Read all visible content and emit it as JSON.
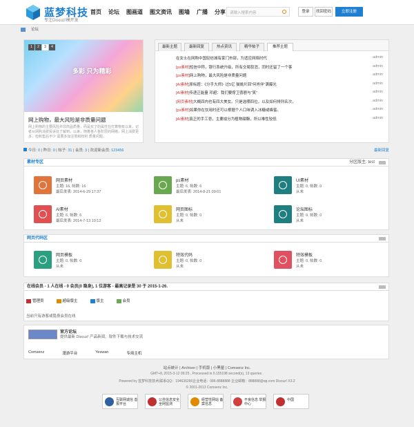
{
  "header": {
    "brand": "蓝梦科技",
    "brand_sub": "专注Discuz!模开发",
    "nav": [
      "首页",
      "论坛",
      "图画道",
      "图文资讯",
      "图墙",
      "广播",
      "分享"
    ],
    "search_placeholder": "请输入搜索内容",
    "login": "登录",
    "forgot": "找回密码",
    "register": "立即注册"
  },
  "breadcrumb": {
    "item": "论坛"
  },
  "slider": {
    "pages": [
      "1",
      "2",
      "3",
      "4"
    ],
    "active_page": "3",
    "image_text": "多彩 只为精彩",
    "title": "网上购物，最大风险是非质量问题",
    "desc": "网上购物的主要风险并非商品质量，而是买了的属性在打算物有以来，记者从网购消费投诉处了解到，以来，随着各人各阶层的网络，网上消费更多，但和售后不少 需要多加注意和权利 质量问题。"
  },
  "tabs": {
    "items": [
      "最新主题",
      "最新回复",
      "热点资讯",
      "精华帖子",
      "推荐主题"
    ],
    "active": "推荐主题",
    "threads": [
      {
        "tag": "",
        "title": "在女士在网购中国轻纺城有家门市部，为适应网络时代",
        "author": "admin"
      },
      {
        "tag": "[ps素材]",
        "title": "短信中称，银行系统升级，所有交易取消，同时还留了一个客",
        "author": "admin"
      },
      {
        "tag": "[ps素材]",
        "title": "网上购物，最大风险是非质量问题",
        "author": "admin"
      },
      {
        "tag": "[AI素材]",
        "title": "原标题：《分手大师》过5亿 猫姚片回“何肖伴”满曝光",
        "author": "admin"
      },
      {
        "tag": "[AI素材]",
        "title": "传递正能量 邓超：我们要撑卫喜剧与“笑”",
        "author": "admin"
      },
      {
        "tag": "[网页素材]",
        "title": "大概四内也有四大美女。只是选哪四位，以及如何排列名次，",
        "author": "admin"
      },
      {
        "tag": "[ps素材]",
        "title": "如果你在饮用时还可以根据个人口味调入冰糖或蜂蜜。",
        "author": "admin"
      },
      {
        "tag": "[AI素材]",
        "title": "真正的手工皂，主要成分为植物甜酯，所以唯性较低",
        "author": "admin"
      }
    ]
  },
  "stats": {
    "today_label": "今日:",
    "today": "0",
    "yesterday_label": "昨日:",
    "yesterday": "0",
    "posts_label": "帖子:",
    "posts": "31",
    "members_label": "会员:",
    "members": "3",
    "welcome_label": "欢迎新会员:",
    "welcome": "123456",
    "newest": "最新回复"
  },
  "section1": {
    "title": "素材专区",
    "right": "分区版主: test",
    "forums": [
      {
        "name": "网页素材",
        "line1": "主题: 16, 帖数: 16",
        "line2": "最后发表: 2014-6-29 17:37",
        "color": "#e0743a"
      },
      {
        "name": "ps素材",
        "line1": "主题: 6, 帖数: 6",
        "line2": "最后发表: 2014-8-21 09:01",
        "color": "#6aa84f"
      },
      {
        "name": "UI素材",
        "line1": "主题: 0, 帖数: 0",
        "line2": "从未",
        "color": "#1f7f80"
      },
      {
        "name": "AI素材",
        "line1": "主题: 6, 帖数: 6",
        "line2": "最后发表: 2014-7-13 10:12",
        "color": "#e05050"
      },
      {
        "name": "网页图标",
        "line1": "主题: 0, 帖数: 0",
        "line2": "从未",
        "color": "#e0c030"
      },
      {
        "name": "论坛图标",
        "line1": "主题: 0, 帖数: 0",
        "line2": "从未",
        "color": "#1f7f80"
      }
    ]
  },
  "section2": {
    "title": "网页代码区",
    "forums": [
      {
        "name": "网页模板",
        "line1": "主题: 0, 帖数: 0",
        "line2": "从未",
        "color": "#2aa080"
      },
      {
        "name": "特效代码",
        "line1": "主题: 0, 帖数: 0",
        "line2": "从未",
        "color": "#e0c030"
      },
      {
        "name": "特效模板",
        "line1": "主题: 0, 帖数: 0",
        "line2": "从未",
        "color": "#e05060"
      }
    ]
  },
  "online": {
    "title": "在线会员 - 1 人在线 - 0 会员(0 隐身), 1 位游客 - 最高记录是 30 于 2015-1-26.",
    "legend": [
      {
        "label": "管理员",
        "color": "#c03030"
      },
      {
        "label": "超级版主",
        "color": "#e08a00"
      },
      {
        "label": "版主",
        "color": "#1f7fd0"
      },
      {
        "label": "会员",
        "color": "#6aa84f"
      }
    ],
    "note": "当前只有游客或隐身会员在线"
  },
  "partner": {
    "name": "官方论坛",
    "desc": "提供最新 Discuz! 产品新闻、软件下载与技术交流",
    "links": [
      "Comsenz",
      "漫游平台",
      "Yeswan",
      "专用主机"
    ]
  },
  "footer": {
    "line1": "站点统计 | Archiver | 手机版 | 小黑屋 | Comsenz Inc.",
    "line2": "GMT+8, 2015-3-12 09:25 , Processed in 0.155198 second(s), 13 queries .",
    "line3": "Powered by 蓝梦科技技术|联系QQ：194636266企业电话：086-8888888 企业邮箱：888888@qq.com Discuz! X3.2",
    "line4": "© 2001-2013 Comsenz Inc.",
    "badges": [
      {
        "text": "互联网诚信 善报平台",
        "color": "#3060a0"
      },
      {
        "text": "公共信息安全 全网监测",
        "color": "#c03030"
      },
      {
        "text": "经营性网站 备案信息",
        "color": "#e08a00"
      },
      {
        "text": "不良信息 举报中心",
        "color": "#d04040"
      },
      {
        "text": "中国",
        "color": "#c03030"
      }
    ]
  }
}
